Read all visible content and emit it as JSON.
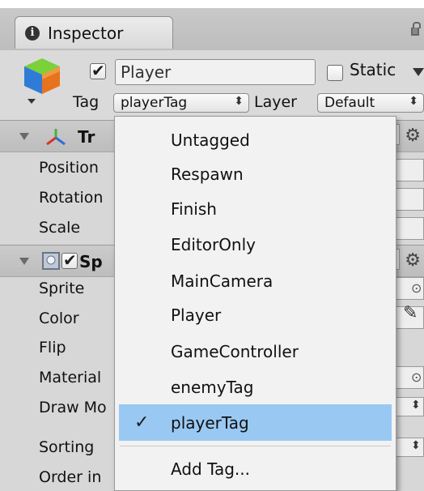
{
  "window": {
    "tab_label": "Inspector"
  },
  "object": {
    "name": "Player",
    "active": true,
    "static_label": "Static",
    "static_checked": false,
    "tag_label": "Tag",
    "tag_value": "playerTag",
    "layer_label": "Layer",
    "layer_value": "Default"
  },
  "components": {
    "transform_title": "Tr",
    "transform_props": [
      "Position",
      "Rotation",
      "Scale"
    ],
    "sprite_title": "Sp",
    "sprite_props": [
      "Sprite",
      "Color",
      "Flip",
      "Material",
      "Draw Mo",
      "Sorting",
      "Order in"
    ]
  },
  "tag_menu": {
    "items": [
      "Untagged",
      "Respawn",
      "Finish",
      "EditorOnly",
      "MainCamera",
      "Player",
      "GameController",
      "enemyTag",
      "playerTag"
    ],
    "selected": "playerTag",
    "check_glyph": "✓",
    "add_label": "Add Tag..."
  },
  "colors": {
    "selection": "#99c9f2",
    "panel": "#d7d7d7",
    "menu": "#f2f2f2"
  },
  "icons": {
    "tab": "info-icon",
    "object": "gameobject-cube-icon",
    "transform": "transform-axes-icon",
    "sprite": "sprite-renderer-icon",
    "settings": "gear-icon",
    "lock": "lock-icon"
  }
}
